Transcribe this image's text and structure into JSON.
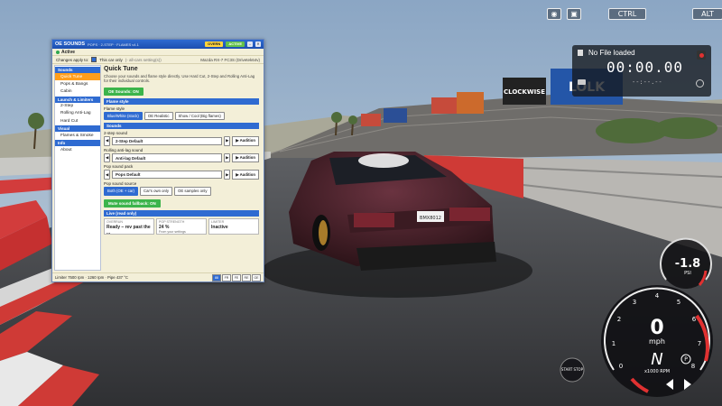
{
  "hud": {
    "ctrl_label": "CTRL",
    "alt_label": "ALT",
    "recorder": {
      "file_status": "No File loaded",
      "time": "00:00.00",
      "sub_time": "--:--.--"
    }
  },
  "window": {
    "title": "OE SOUNDS",
    "title_sub": "POPS · 2-STEP · FLAMES  v4.1",
    "badge_yellow": "OVERN",
    "badge_green": "ACTIVE",
    "status": "Active",
    "changes_label": "Changes apply to:",
    "this_car_label": "This car only",
    "all_cars_label": "(- all-cars setting(s))",
    "car_name": "Mazda RX-7 FC3S (Drivetek64v)",
    "sidebar": [
      {
        "header": "Sounds",
        "items": [
          "Quick Tune",
          "Pops & Bangs",
          "Cabin"
        ]
      },
      {
        "header": "Launch & Limiters",
        "items": [
          "2-Step",
          "Rolling Anti-Lag",
          "Hard Cut"
        ]
      },
      {
        "header": "Visual",
        "items": [
          "Flames & Smoke"
        ]
      },
      {
        "header": "Info",
        "items": [
          "About"
        ]
      }
    ],
    "main": {
      "title": "Quick Tune",
      "description": "Choose your sounds and flame style directly. Use Hard Cut, 2-Step and Rolling Anti-Lag for their individual controls.",
      "oe_sounds_button": "OE Sounds: ON",
      "flame_section": "Flame style",
      "flame_label": "Flame style",
      "flame_options": [
        "Blue/White (stock)",
        "OE Realistic",
        "Show / Cool (Big flames)"
      ],
      "sounds_section": "Sounds",
      "two_step_label": "2-step sound",
      "two_step_value": "2-Step Default",
      "rolling_label": "Rolling anti-lag sound",
      "rolling_value": "Anti-lag Default",
      "pop_label": "Pop sound pack",
      "pop_value": "Pops Default",
      "audition_label": "▶ Audition",
      "pop_source_label": "Pop sound source",
      "pop_source_options": [
        "Both (OE + car)",
        "Car's own only",
        "OE samples only"
      ],
      "fallback_button": "Mute sound fallback: ON",
      "live_section": "Live (read only)",
      "live": [
        {
          "h": "OVERRUN",
          "v": "Ready – rev past the ...",
          "s": ""
        },
        {
          "h": "POP STRENGTH",
          "v": "24 %",
          "s": "From your settings"
        },
        {
          "h": "LIMITER",
          "v": "Inactive",
          "s": ""
        }
      ]
    },
    "footer_text": "Limiter 7500 rpm · 1260 rpm · Pipe 437 °C",
    "footer_toggles": [
      "88",
      "FR",
      "FE",
      "RE",
      "GE"
    ]
  },
  "gauges": {
    "small_value": "-1.8",
    "small_unit": "PSI",
    "speed": "0",
    "speed_unit": "mph",
    "gear": "N",
    "rpm_label": "x1000 RPM",
    "rpm_ticks": [
      "0",
      "1",
      "2",
      "3",
      "4",
      "5",
      "6",
      "7",
      "8"
    ],
    "start_stop": "START STOP",
    "drive_mode": "P"
  },
  "scene": {
    "banners": [
      "CLOCKWISE",
      "LOLK"
    ],
    "plate": "BMX8012"
  },
  "colors": {
    "accent": "#2f6bd1",
    "selected": "#ff9e1b",
    "ok": "#3cb44b",
    "redline": "#e03131"
  }
}
